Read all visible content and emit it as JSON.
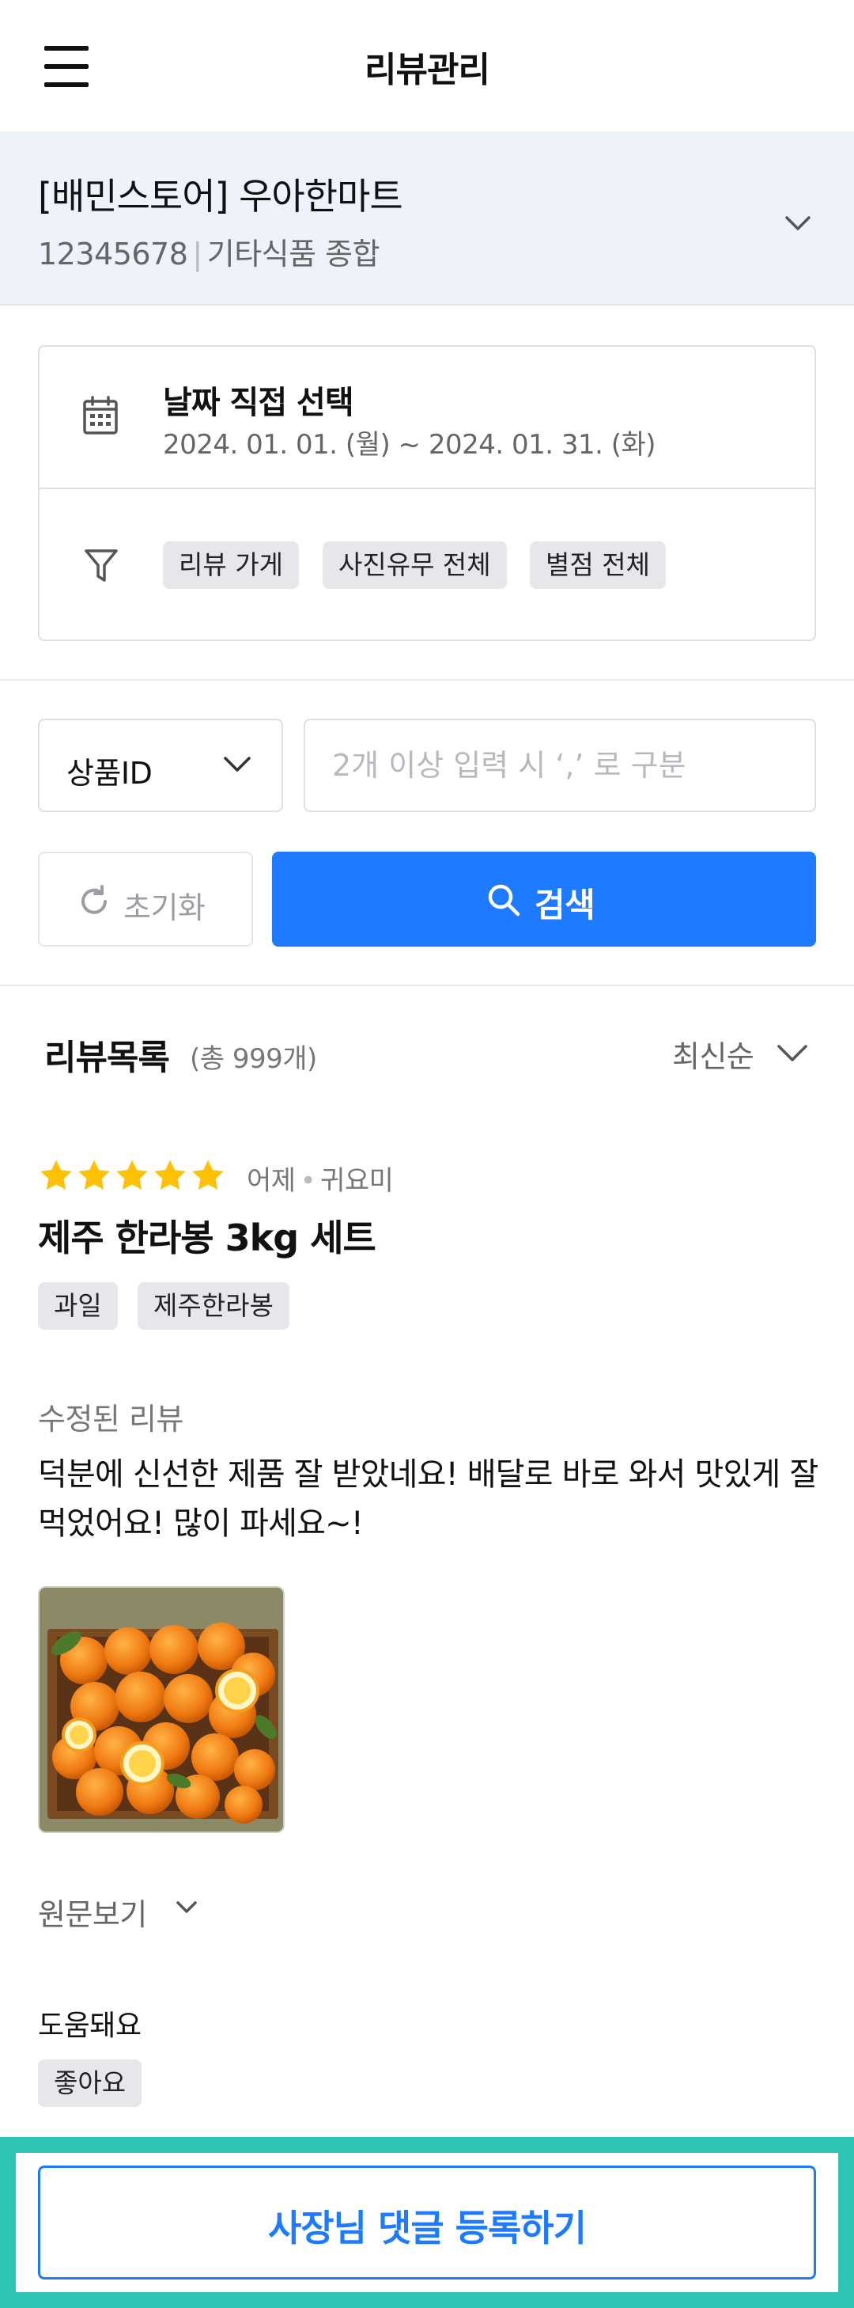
{
  "header": {
    "title": "리뷰관리"
  },
  "store": {
    "name": "[배민스토어] 우아한마트",
    "id": "12345678",
    "category": "기타식품 종합"
  },
  "filter": {
    "date_title": "날짜 직접 선택",
    "date_range": "2024. 01. 01. (월) ~ 2024. 01. 31. (화)",
    "chips": [
      "리뷰 가게",
      "사진유무 전체",
      "별점 전체"
    ]
  },
  "search": {
    "select_value": "상품ID",
    "input_placeholder": "2개 이상 입력 시 ‘,’ 로 구분",
    "reset_label": "초기화",
    "search_label": "검색"
  },
  "review_list": {
    "title": "리뷰목록",
    "count": "(총 999개)",
    "sort_label": "최신순"
  },
  "review": {
    "rating": 5,
    "date": "어제",
    "author": "귀요미",
    "product_name": "제주 한라봉 3kg 세트",
    "tags": [
      "과일",
      "제주한라봉"
    ],
    "edited_label": "수정된 리뷰",
    "text": "덕분에 신선한 제품 잘 받았네요! 배달로 바로 와서 맛있게 잘 먹었어요! 많이 파세요~!",
    "original_label": "원문보기",
    "helpful_label": "도움돼요",
    "helpful_chip": "좋아요"
  },
  "cta": {
    "label": "사장님 댓글 등록하기"
  },
  "colors": {
    "accent": "#1e7bff",
    "star": "#ffc107",
    "highlight": "#2ec4b6"
  }
}
